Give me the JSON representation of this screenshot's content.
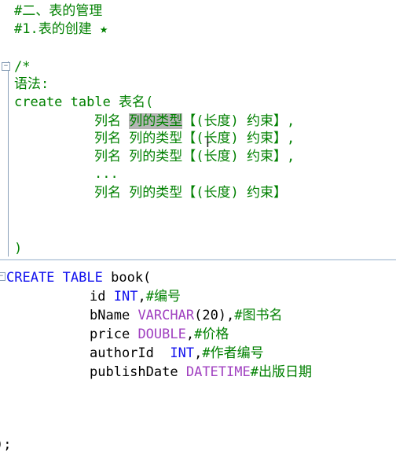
{
  "top_editor": {
    "lines": [
      "#二、表的管理",
      "#1.表的创建 ★",
      "/*",
      "语法:",
      "create table 表名(",
      "列的类型【(长度) 约束】,",
      "列的类型【(长度) 约束】,",
      "列的类型【(长度) 约束】,",
      "...",
      "列名 列的类型【(长度) 约束】",
      ")"
    ],
    "col_name": "列名",
    "selected_text": "列的类型"
  },
  "bottom_editor": {
    "create_kw": "CREATE",
    "table_kw": "TABLE",
    "table_name": "book(",
    "columns": [
      {
        "name": "id",
        "type": "INT",
        "sep": ",",
        "comment": "#编号"
      },
      {
        "name": "bName",
        "type": "VARCHAR",
        "args": "(20)",
        "sep": ",",
        "comment": "#图书名"
      },
      {
        "name": "price",
        "type": "DOUBLE",
        "sep": ",",
        "comment": "#价格"
      },
      {
        "name": "authorId",
        "type": "INT",
        "sep": ",",
        "comment": "#作者编号"
      },
      {
        "name": "publishDate",
        "type": "DATETIME",
        "sep": "",
        "comment": "#出版日期"
      }
    ],
    "close": ");"
  }
}
